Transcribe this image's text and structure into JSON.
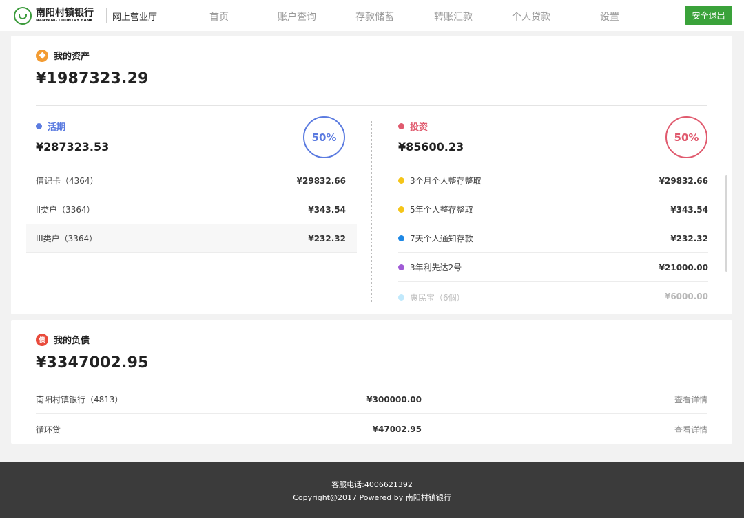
{
  "header": {
    "logo_cn": "南阳村镇银行",
    "logo_en": "NANYANG COUNTRY BANK",
    "site_name": "网上营业厅",
    "nav": [
      "首页",
      "账户查询",
      "存款储蓄",
      "转账汇款",
      "个人贷款",
      "设置"
    ],
    "logout_label": "安全退出"
  },
  "assets": {
    "title": "我的资产",
    "icon": "diamond-icon",
    "total": "¥1987323.29",
    "current": {
      "title": "活期",
      "amount": "¥287323.53",
      "percent": "50%",
      "color": "#5b7be0",
      "rows": [
        {
          "label": "借记卡（4364）",
          "value": "¥29832.66"
        },
        {
          "label": "II类户（3364）",
          "value": "¥343.54"
        },
        {
          "label": "III类户（3364）",
          "value": "¥232.32"
        }
      ]
    },
    "investment": {
      "title": "投资",
      "amount": "¥85600.23",
      "percent": "50%",
      "color": "#e05a6e",
      "rows": [
        {
          "label": "3个月个人整存整取",
          "value": "¥29832.66",
          "color": "#f5c518"
        },
        {
          "label": "5年个人整存整取",
          "value": "¥343.54",
          "color": "#f5c518"
        },
        {
          "label": "7天个人通知存款",
          "value": "¥232.32",
          "color": "#1e88e5"
        },
        {
          "label": "3年利先达2号",
          "value": "¥21000.00",
          "color": "#a05bd6"
        },
        {
          "label": "惠民宝（6個）",
          "value": "¥6000.00",
          "color": "#4fc3f7"
        }
      ]
    }
  },
  "debt": {
    "title": "我的负债",
    "icon_text": "债",
    "total": "¥3347002.95",
    "rows": [
      {
        "label": "南阳村镇银行（4813）",
        "value": "¥300000.00",
        "link": "查看详情"
      },
      {
        "label": "循环贷",
        "value": "¥47002.95",
        "link": "查看详情"
      }
    ]
  },
  "footer": {
    "phone": "客服电话:4006621392",
    "copyright": "Copyright@2017 Powered by 南阳村镇银行"
  },
  "colors": {
    "brand_green": "#3aa23a",
    "asset_icon": "#f39c33",
    "debt_icon": "#e94b3c"
  }
}
